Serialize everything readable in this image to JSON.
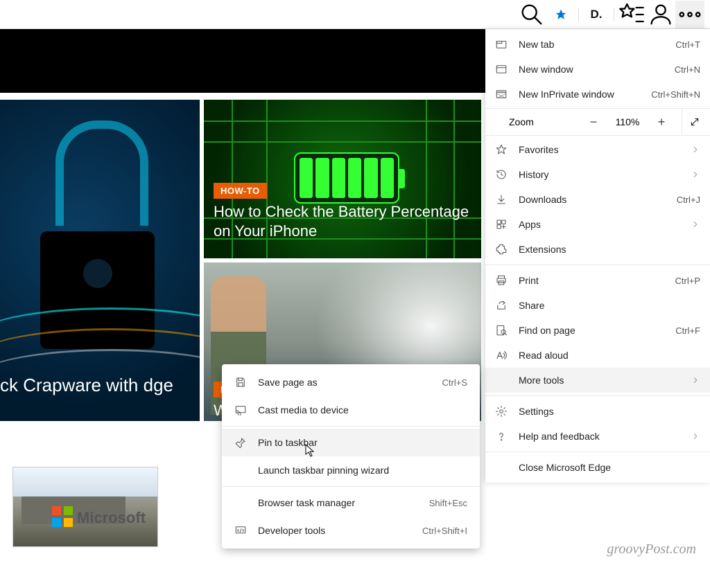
{
  "zoom": {
    "label": "Zoom",
    "percent": "110%"
  },
  "menu": {
    "new_tab": {
      "label": "New tab",
      "shortcut": "Ctrl+T"
    },
    "new_window": {
      "label": "New window",
      "shortcut": "Ctrl+N"
    },
    "new_inprivate": {
      "label": "New InPrivate window",
      "shortcut": "Ctrl+Shift+N"
    },
    "favorites": {
      "label": "Favorites"
    },
    "history": {
      "label": "History"
    },
    "downloads": {
      "label": "Downloads",
      "shortcut": "Ctrl+J"
    },
    "apps": {
      "label": "Apps"
    },
    "extensions": {
      "label": "Extensions"
    },
    "print": {
      "label": "Print",
      "shortcut": "Ctrl+P"
    },
    "share": {
      "label": "Share"
    },
    "find": {
      "label": "Find on page",
      "shortcut": "Ctrl+F"
    },
    "read_aloud": {
      "label": "Read aloud"
    },
    "more_tools": {
      "label": "More tools"
    },
    "settings": {
      "label": "Settings"
    },
    "help": {
      "label": "Help and feedback"
    },
    "close": {
      "label": "Close Microsoft Edge"
    }
  },
  "submenu": {
    "save_as": {
      "label": "Save page as",
      "shortcut": "Ctrl+S"
    },
    "cast": {
      "label": "Cast media to device"
    },
    "pin": {
      "label": "Pin to taskbar"
    },
    "wizard": {
      "label": "Launch taskbar pinning wizard"
    },
    "task_manager": {
      "label": "Browser task manager",
      "shortcut": "Shift+Esc"
    },
    "dev_tools": {
      "label": "Developer tools",
      "shortcut": "Ctrl+Shift+I"
    }
  },
  "cards": {
    "left": {
      "tag": "",
      "title": "ck Crapware with dge"
    },
    "top": {
      "tag": "HOW-TO",
      "title": "How to Check the Battery Percentage on Your iPhone"
    },
    "bottom": {
      "tag": "HOW-TO",
      "title": "W"
    }
  },
  "building_label": "Microsoft",
  "watermark": "groovyPost.com"
}
